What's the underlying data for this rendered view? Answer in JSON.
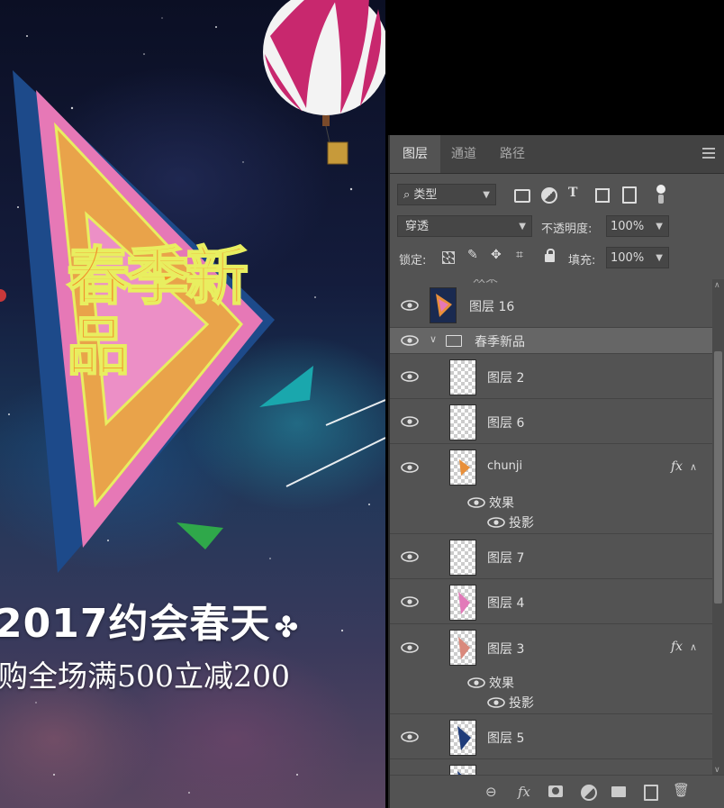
{
  "canvas": {
    "title_art": "春季新品",
    "headline": "2017约会春天",
    "headline_glyph": "✤",
    "subline": "购全场满500立减200"
  },
  "panel": {
    "tabs": [
      {
        "label": "图层",
        "active": true
      },
      {
        "label": "通道",
        "active": false
      },
      {
        "label": "路径",
        "active": false
      }
    ],
    "filter": {
      "value": "类型",
      "icons": [
        "image-filter-icon",
        "adjustment-filter-icon",
        "text-filter-icon",
        "shape-filter-icon",
        "smart-object-filter-icon",
        "filter-toggle-icon"
      ]
    },
    "blend_mode": "穿透",
    "opacity_label": "不透明度:",
    "opacity_value": "100%",
    "lock_label": "锁定:",
    "fill_label": "填充:",
    "fill_value": "100%",
    "layers": [
      {
        "name": "图层 16",
        "type": "layer",
        "thumb": "artwork"
      },
      {
        "name": "春季新品",
        "type": "group"
      },
      {
        "name": "图层 2",
        "type": "layer",
        "thumb": "empty"
      },
      {
        "name": "图层 6",
        "type": "layer",
        "thumb": "empty"
      },
      {
        "name": "chunji",
        "type": "layer",
        "thumb": "orange",
        "fx": "fx",
        "effects_label": "效果",
        "effect": "投影"
      },
      {
        "name": "图层 7",
        "type": "layer",
        "thumb": "empty"
      },
      {
        "name": "图层 4",
        "type": "layer",
        "thumb": "pink"
      },
      {
        "name": "图层 3",
        "type": "layer",
        "thumb": "salmon",
        "fx": "fx",
        "effects_label": "效果",
        "effect": "投影"
      },
      {
        "name": "图层 5",
        "type": "layer",
        "thumb": "navy"
      }
    ],
    "partial_top_label": "效果",
    "bottom_icons": [
      "link-layers-icon",
      "fx-icon",
      "mask-icon",
      "adjustment-layer-icon",
      "new-group-icon",
      "new-layer-icon",
      "delete-icon"
    ],
    "bottom_fx_label": "fx",
    "colors": {
      "panel_bg": "#535353",
      "tab_bar": "#424242",
      "selected_group": "#666666"
    }
  }
}
